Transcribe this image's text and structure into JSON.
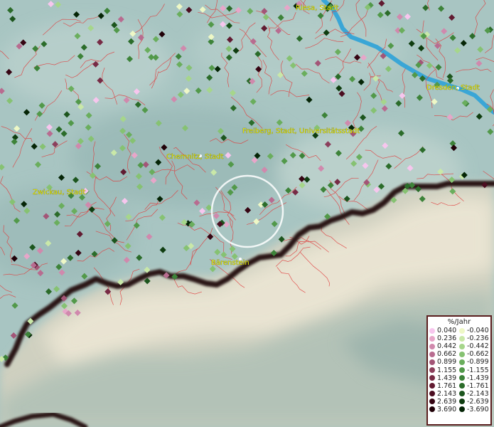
{
  "map": {
    "cities": [
      {
        "id": "riesa",
        "label": "Riesa, Stadt"
      },
      {
        "id": "dresden",
        "label": "Dresden, Stadt"
      },
      {
        "id": "freiberg",
        "label": "Freiberg, Stadt, Universitätsstadt"
      },
      {
        "id": "chemnitz",
        "label": "Chemnitz, Stadt"
      },
      {
        "id": "zwickau",
        "label": "Zwickau, Stadt"
      },
      {
        "id": "baerenstein",
        "label": "Bärenstein"
      }
    ],
    "colors": {
      "land_shadow": "#8fb2b0",
      "land": "#a8c5c2",
      "mountains": "#d9d6c3",
      "river": "#3aa6d6",
      "borders": "#e03a3a",
      "state_border": "#1a0a0a",
      "selection_ring": "#ffffff"
    }
  },
  "legend": {
    "title": "%/Jahr",
    "positive": [
      {
        "label": "0.040",
        "color": "#f7c6ee"
      },
      {
        "label": "0.236",
        "color": "#e7a6c9"
      },
      {
        "label": "0.442",
        "color": "#d089ad"
      },
      {
        "label": "0.662",
        "color": "#b86c90"
      },
      {
        "label": "0.899",
        "color": "#a35577"
      },
      {
        "label": "1.155",
        "color": "#8c3f5c"
      },
      {
        "label": "1.439",
        "color": "#772b45"
      },
      {
        "label": "1.761",
        "color": "#611a31"
      },
      {
        "label": "2.143",
        "color": "#4b0d20"
      },
      {
        "label": "2.639",
        "color": "#360513"
      },
      {
        "label": "3.690",
        "color": "#200108"
      }
    ],
    "negative": [
      {
        "label": "-0.040",
        "color": "#eef8c6"
      },
      {
        "label": "-0.236",
        "color": "#c9e8a8"
      },
      {
        "label": "-0.442",
        "color": "#a6d68b"
      },
      {
        "label": "-0.662",
        "color": "#86c272"
      },
      {
        "label": "-0.899",
        "color": "#6aae5d"
      },
      {
        "label": "-1.155",
        "color": "#52994a"
      },
      {
        "label": "-1.439",
        "color": "#3d8339"
      },
      {
        "label": "-1.761",
        "color": "#2b6c2a"
      },
      {
        "label": "-2.143",
        "color": "#1c551d"
      },
      {
        "label": "-2.639",
        "color": "#0f3d10"
      },
      {
        "label": "-3.690",
        "color": "#052506"
      }
    ]
  }
}
